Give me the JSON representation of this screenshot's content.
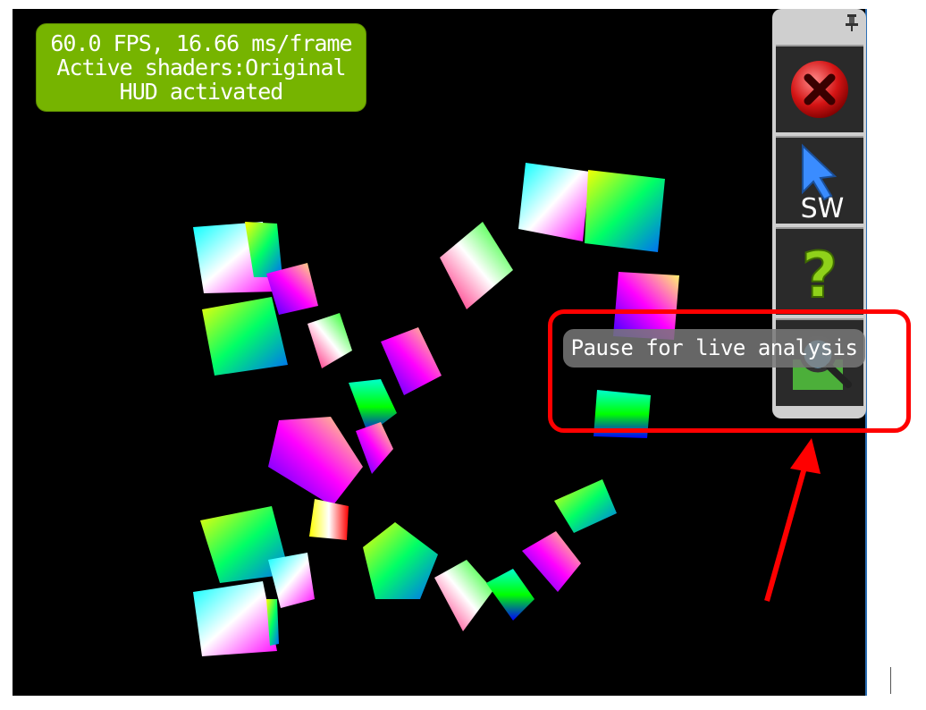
{
  "hud": {
    "line1": "60.0 FPS, 16.66 ms/frame",
    "line2": "Active shaders:Original",
    "line3": "HUD activated",
    "color": "#76b400"
  },
  "toolbar": {
    "pin_icon": "pin-icon",
    "buttons": [
      {
        "name": "close-button",
        "icon": "red-x-icon"
      },
      {
        "name": "switch-button",
        "icon": "cursor-arrow-icon",
        "label": "SW"
      },
      {
        "name": "help-button",
        "icon": "question-mark-icon",
        "label": "?"
      },
      {
        "name": "pause-analysis-button",
        "icon": "magnifier-icon"
      }
    ]
  },
  "tooltip": {
    "text": "Pause for live analysis"
  },
  "annotation": {
    "color": "#ff0000"
  }
}
